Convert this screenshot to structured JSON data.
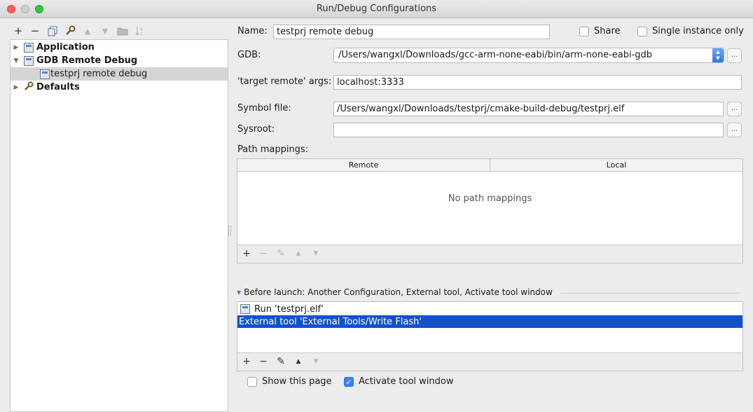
{
  "window": {
    "title": "Run/Debug Configurations"
  },
  "left_toolbar": {
    "add": "+",
    "remove": "−"
  },
  "tree": [
    {
      "label": "Application",
      "level": 0,
      "bold": true,
      "expanded": false
    },
    {
      "label": "GDB Remote Debug",
      "level": 0,
      "bold": true,
      "expanded": true
    },
    {
      "label": "testprj remote debug",
      "level": 1,
      "bold": false,
      "selected": true
    },
    {
      "label": "Defaults",
      "level": 0,
      "bold": true,
      "expanded": false
    }
  ],
  "form": {
    "name_label": "Name:",
    "name_value": "testprj remote debug",
    "share_label": "Share",
    "single_instance_label": "Single instance only",
    "gdb_label": "GDB:",
    "gdb_value": "/Users/wangxl/Downloads/gcc-arm-none-eabi/bin/arm-none-eabi-gdb",
    "target_remote_label": "'target remote' args:",
    "target_remote_value": "localhost:3333",
    "symbol_file_label": "Symbol file:",
    "symbol_file_value": "/Users/wangxl/Downloads/testprj/cmake-build-debug/testprj.elf",
    "sysroot_label": "Sysroot:",
    "sysroot_value": "",
    "browse_label": "...",
    "path_mappings_label": "Path mappings:",
    "path_mappings_columns": [
      "Remote",
      "Local"
    ],
    "path_mappings_empty": "No path mappings"
  },
  "before_launch": {
    "header": "Before launch: Another Configuration, External tool, Activate tool window",
    "items": [
      {
        "label": "Run 'testprj.elf'",
        "selected": false
      },
      {
        "label": "External tool 'External Tools/Write Flash'",
        "selected": true
      }
    ]
  },
  "options": {
    "show_page_label": "Show this page",
    "show_page_checked": false,
    "activate_window_label": "Activate tool window",
    "activate_window_checked": true
  },
  "mini_toolbar": {
    "add": "+",
    "remove": "−"
  }
}
